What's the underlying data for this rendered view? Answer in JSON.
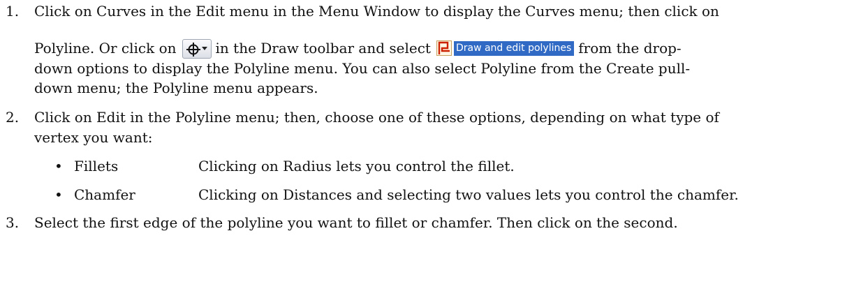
{
  "steps": [
    {
      "number": "1.",
      "line1": "Click on Curves in the Edit menu in the Menu Window to display the Curves menu; then click on",
      "line2_a": "Polyline. Or click on",
      "line2_b": "in the Draw toolbar and select",
      "line2_c": "from the drop-",
      "line3": "down options to display the Polyline menu. You can also select Polyline from the Create pull-",
      "line4": "down menu; the Polyline menu appears."
    },
    {
      "number": "2.",
      "line1": "Click on Edit in the Polyline menu; then, choose one of these options, depending on what type of",
      "line2": "vertex you want:",
      "options": [
        {
          "bullet": "•",
          "term": "Fillets",
          "description": "Clicking on Radius lets you control the fillet."
        },
        {
          "bullet": "•",
          "term": "Chamfer",
          "description": "Clicking on Distances and selecting two values lets you control the chamfer."
        }
      ]
    },
    {
      "number": "3.",
      "line1": "Select the first edge of the polyline you want to fillet or chamfer. Then click on the second."
    }
  ],
  "draw_toolbar_button": {
    "icon": "crosshair-circle-icon",
    "dropdown_icon": "dropdown-arrow-icon"
  },
  "dropdown_option": {
    "icon": "polyline-icon",
    "label": "Draw and edit polylines",
    "highlight_color": "#316ac5",
    "icon_color": "#cc2200"
  }
}
